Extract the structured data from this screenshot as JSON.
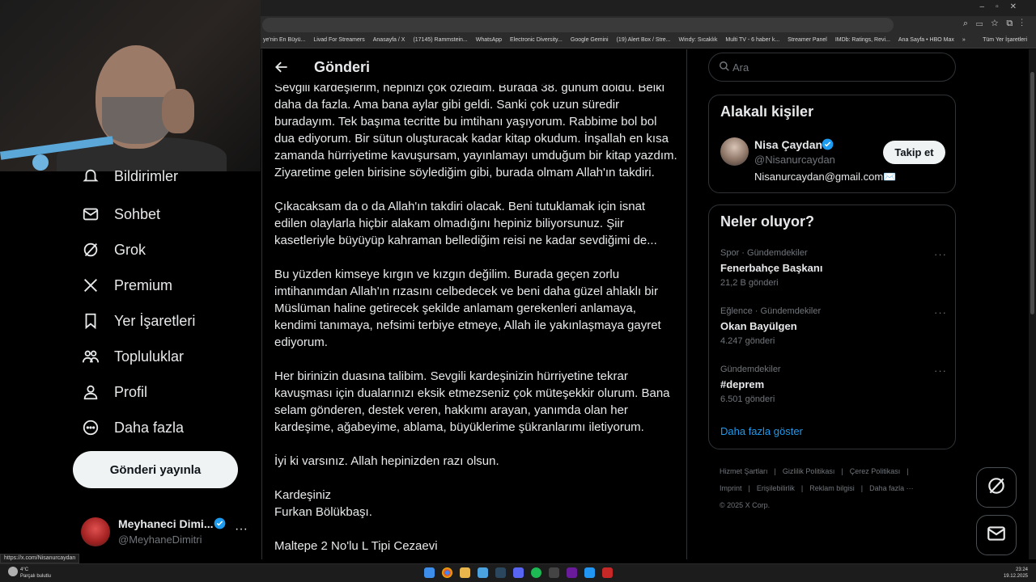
{
  "browser": {
    "window_controls": [
      "–",
      "▫",
      "✕"
    ],
    "bookmarks": [
      "ye'nin En Büyü...",
      "Livad For Streamers",
      "Anasayfa / X",
      "(17145) Rammstein...",
      "WhatsApp",
      "Electronic Diversity...",
      "Google Gemini",
      "(19) Alert Box / Stre...",
      "Windy: Sıcaklık",
      "Multi TV - 6 haber k...",
      "Streamer Panel",
      "IMDb: Ratings, Revi...",
      "Ana Sayfa • HBO Max"
    ],
    "bookmarks_overflow": "»",
    "all_bookmarks": "Tüm Yer İşaretleri"
  },
  "sidebar": {
    "items": [
      {
        "label": "Bildirimler",
        "icon": "bell-icon"
      },
      {
        "label": "Sohbet",
        "icon": "mail-icon"
      },
      {
        "label": "Grok",
        "icon": "grok-icon"
      },
      {
        "label": "Premium",
        "icon": "x-logo-icon"
      },
      {
        "label": "Yer İşaretleri",
        "icon": "bookmark-icon"
      },
      {
        "label": "Topluluklar",
        "icon": "people-icon"
      },
      {
        "label": "Profil",
        "icon": "person-icon"
      },
      {
        "label": "Daha fazla",
        "icon": "more-circle-icon"
      }
    ],
    "post_button": "Gönderi yayınla",
    "profile": {
      "name": "Meyhaneci Dimi...",
      "handle": "@MeyhaneDimitri",
      "more": "···"
    }
  },
  "main": {
    "title": "Gönderi",
    "paragraphs": [
      "Sevgili kardeşlerim, hepinizi çok özledim. Burada 38. günüm doldu. Belki daha da fazla. Ama bana aylar gibi geldi. Sanki çok uzun süredir buradayım. Tek başıma tecritte bu imtihanı yaşıyorum. Rabbime bol bol dua ediyorum. Bir sütun oluşturacak kadar kitap okudum. İnşallah en kısa zamanda hürriyetime kavuşursam, yayınlamayı umduğum bir kitap yazdım. Ziyaretime gelen birisine söylediğim gibi, burada olmam Allah'ın takdiri.",
      "Çıkacaksam da o da Allah'ın takdiri olacak. Beni tutuklamak için isnat edilen olaylarla hiçbir alakam olmadığını hepiniz biliyorsunuz. Şiir kasetleriyle büyüyüp kahraman bellediğim reisi ne kadar sevdiğimi de...",
      "Bu yüzden kimseye kırgın ve kızgın değilim. Burada geçen zorlu imtihanımdan Allah'ın rızasını celbedecek ve beni daha güzel ahlaklı bir Müslüman haline getirecek şekilde anlamam gerekenleri anlamaya, kendimi tanımaya, nefsimi terbiye etmeye, Allah ile yakınlaşmaya gayret ediyorum.",
      "Her birinizin duasına talibim. Sevgili kardeşinizin hürriyetine tekrar kavuşması için dualarınızı eksik etmezseniz çok müteşekkir olurum. Bana selam gönderen, destek veren, hakkımı arayan, yanımda olan her kardeşime, ağabeyime, ablama, büyüklerime şükranlarımı iletiyorum.",
      "İyi ki varsınız. Allah hepinizden razı olsun.",
      "Kardeşiniz\nFurkan Bölükbaşı.",
      "Maltepe 2 No'lu L Tipi Cezaevi"
    ]
  },
  "search": {
    "placeholder": "Ara"
  },
  "related": {
    "title": "Alakalı kişiler",
    "name": "Nisa Çaydan",
    "handle": "@Nisanurcaydan",
    "bio": "Nisanurcaydan@gmail.com✉️",
    "follow": "Takip et"
  },
  "trends": {
    "title": "Neler oluyor?",
    "items": [
      {
        "category": "Spor · Gündemdekiler",
        "name": "Fenerbahçe Başkanı",
        "count": "21,2 B gönderi"
      },
      {
        "category": "Eğlence · Gündemdekiler",
        "name": "Okan Bayülgen",
        "count": "4.247 gönderi"
      },
      {
        "category": "Gündemdekiler",
        "name": "#deprem",
        "count": "6.501 gönderi"
      }
    ],
    "more": "···",
    "show_more": "Daha fazla göster"
  },
  "footer": {
    "links": [
      "Hizmet Şartları",
      "Gizlilik Politikası",
      "Çerez Politikası",
      "Imprint",
      "Erişilebilirlik",
      "Reklam bilgisi",
      "Daha fazla ···"
    ],
    "copyright": "© 2025 X Corp."
  },
  "status_url": "https://x.com/Nisanurcaydan",
  "taskbar": {
    "temperature": "4°C",
    "weather": "Parçalı bulutlu",
    "time": "23:24",
    "date": "19.12.2025",
    "icons": [
      "windows-icon",
      "chrome-icon",
      "folder-icon",
      "app-icon-1",
      "steam-icon",
      "discord-icon",
      "spotify-icon",
      "app-icon-2",
      "app-icon-3",
      "app-icon-4",
      "app-icon-5"
    ]
  },
  "colors": {
    "accent": "#1d9bf0",
    "verified": "#1d9bf0",
    "bg": "#000000",
    "muted": "#71767b"
  }
}
